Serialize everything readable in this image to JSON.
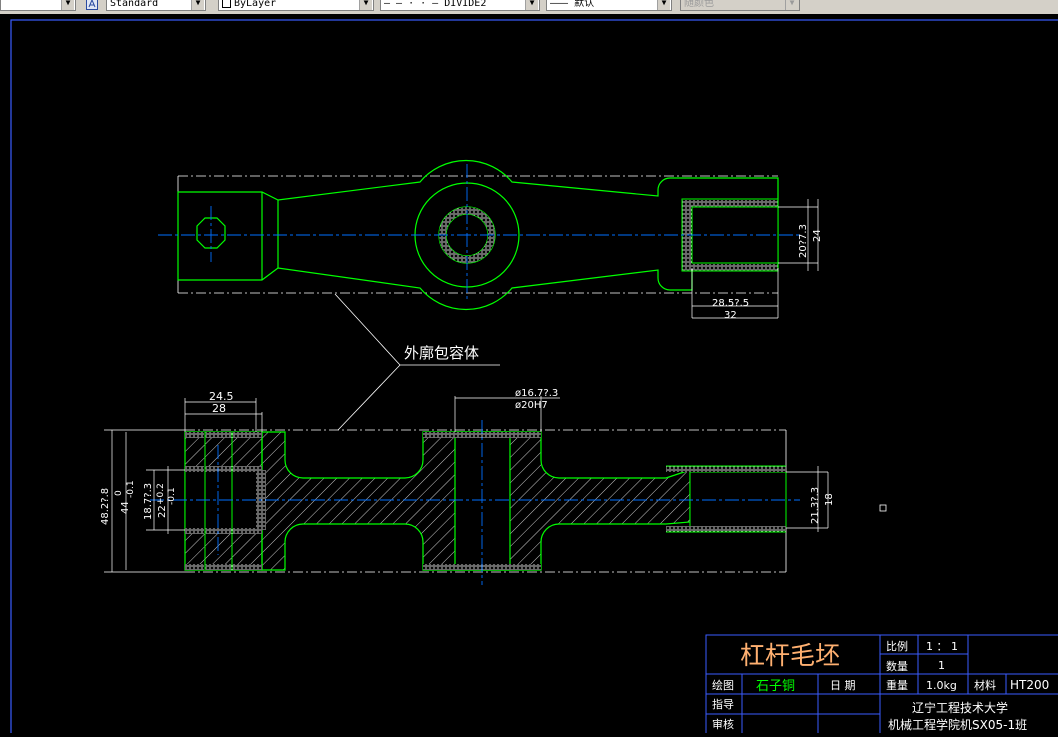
{
  "toolbar": {
    "combo1_text": "",
    "style": "Standard",
    "layer": "ByLayer",
    "linetype": "— — · · — DIVIDE2",
    "lineweight": "——— 默认",
    "color": "随颜色"
  },
  "drawing": {
    "callout": "外廓包容体",
    "top_view": {
      "dim_width_a": "28.5?.5",
      "dim_width_b": "32",
      "dim_height_a": "20?7.3",
      "dim_height_b": "24"
    },
    "section_view": {
      "dim_top_a": "24.5",
      "dim_top_b": "28",
      "dim_bore_a": "ø16.7?.3",
      "dim_bore_b": "ø20H7",
      "dim_left_outer_a": "48.2?.8",
      "dim_left_outer_b0": "0",
      "dim_left_outer_b": "44",
      "dim_left_outer_b1": "-0.1",
      "dim_left_inner_a": "18.7?.3",
      "dim_left_inner_b": "22",
      "dim_left_inner_b0": "+0.2",
      "dim_left_inner_b1": "-0.1",
      "dim_right_a": "21.3?.3",
      "dim_right_b": "18"
    }
  },
  "title_block": {
    "title": "杠杆毛坯",
    "scale_label": "比例",
    "scale_value": "1 ： 1",
    "qty_label": "数量",
    "qty_value": "1",
    "drawn_label": "绘图",
    "drawn_value": "石子铜",
    "date_label": "日  期",
    "weight_label": "重量",
    "weight_value": "1.0kg",
    "material_label": "材料",
    "material_value": "HT200",
    "guide_label": "指导",
    "review_label": "审核",
    "school": "辽宁工程技术大学",
    "class": "机械工程学院机SX05-1班"
  },
  "colors": {
    "outline": "#00ff00",
    "centerline": "#0070ff",
    "dimension": "#ffffff",
    "title_text": "#ffb070",
    "frame": "#3a5cff"
  }
}
